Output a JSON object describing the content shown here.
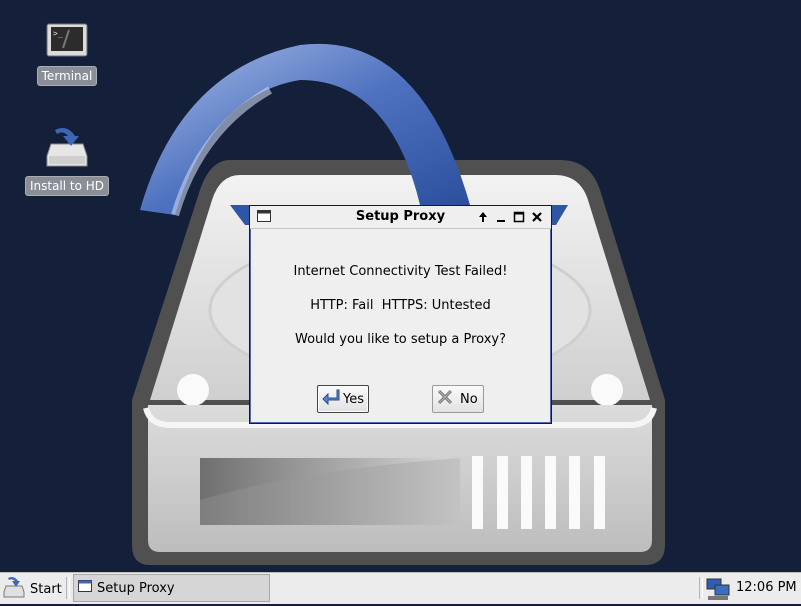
{
  "desktop": {
    "icons": [
      {
        "label": "Terminal",
        "icon": "terminal-icon"
      },
      {
        "label": "Install to HD",
        "icon": "install-drive-icon"
      }
    ]
  },
  "dialog": {
    "title": "Setup Proxy",
    "controls": [
      "pin-up-icon",
      "minimize-icon",
      "maximize-icon",
      "close-icon"
    ],
    "line1": "Internet Connectivity Test Failed!",
    "line2": "HTTP: Fail  HTTPS: Untested",
    "line3": "Would you like to setup a Proxy?",
    "yes_label": "Yes",
    "no_label": "No"
  },
  "taskbar": {
    "start_label": "Start",
    "task_label": "Setup Proxy",
    "clock": "12:06 PM"
  },
  "colors": {
    "desktop_bg": "#14203a",
    "accent_blue": "#3b5ea8",
    "dialog_bg": "#efefef"
  }
}
